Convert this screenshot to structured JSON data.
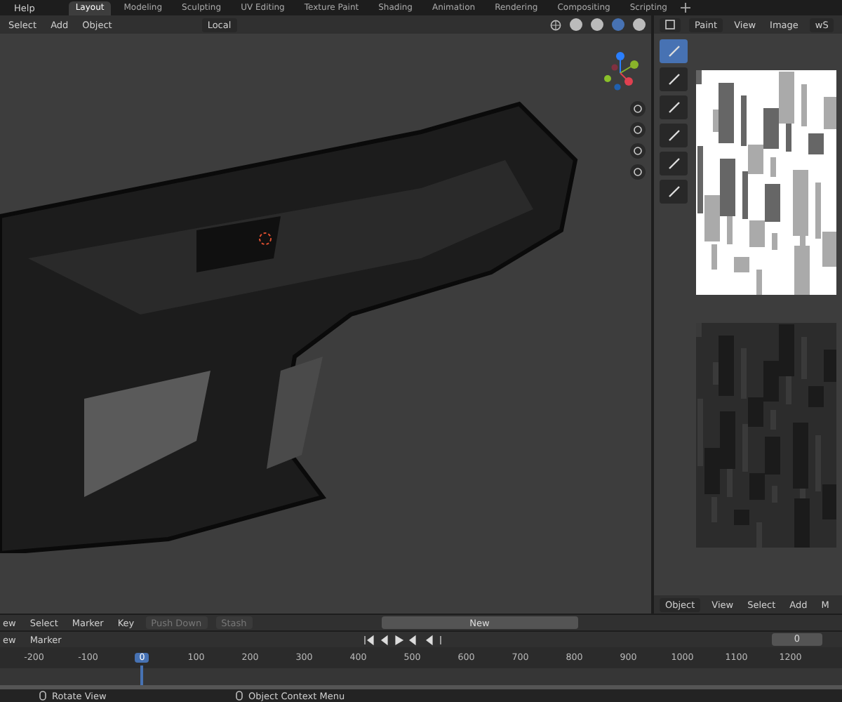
{
  "top_menu": [
    "Help"
  ],
  "workspace_tabs": [
    {
      "label": "Layout",
      "selected": true
    },
    {
      "label": "Modeling",
      "selected": false
    },
    {
      "label": "Sculpting",
      "selected": false
    },
    {
      "label": "UV Editing",
      "selected": false
    },
    {
      "label": "Texture Paint",
      "selected": false
    },
    {
      "label": "Shading",
      "selected": false
    },
    {
      "label": "Animation",
      "selected": false
    },
    {
      "label": "Rendering",
      "selected": false
    },
    {
      "label": "Compositing",
      "selected": false
    },
    {
      "label": "Scripting",
      "selected": false
    }
  ],
  "viewport": {
    "menus": [
      "Select",
      "Add",
      "Object"
    ],
    "orientation": "Local",
    "shading_modes": [
      {
        "selected": false
      },
      {
        "selected": false
      },
      {
        "selected": true
      },
      {
        "selected": false
      }
    ]
  },
  "image_editor": {
    "mode": "Paint",
    "menus": [
      "View",
      "Image"
    ],
    "image_name": "wS",
    "tools": [
      {
        "selected": true
      },
      {
        "selected": false
      },
      {
        "selected": false
      },
      {
        "selected": false
      },
      {
        "selected": false
      },
      {
        "selected": false
      }
    ]
  },
  "lower_header": {
    "mode": "Object",
    "menus": [
      "View",
      "Select",
      "Add",
      "M"
    ]
  },
  "dope_sheet": {
    "menus": [
      "ew",
      "Select",
      "Marker",
      "Key"
    ],
    "buttons": [
      "Push Down",
      "Stash"
    ],
    "action_button": "New"
  },
  "timeline": {
    "menus": [
      "ew",
      "Marker"
    ],
    "current_frame": "0",
    "ruler": [
      {
        "label": "-200",
        "selected": false
      },
      {
        "label": "-100",
        "selected": false
      },
      {
        "label": "0",
        "selected": true
      },
      {
        "label": "100",
        "selected": false
      },
      {
        "label": "200",
        "selected": false
      },
      {
        "label": "300",
        "selected": false
      },
      {
        "label": "400",
        "selected": false
      },
      {
        "label": "500",
        "selected": false
      },
      {
        "label": "600",
        "selected": false
      },
      {
        "label": "700",
        "selected": false
      },
      {
        "label": "800",
        "selected": false
      },
      {
        "label": "900",
        "selected": false
      },
      {
        "label": "1000",
        "selected": false
      },
      {
        "label": "1100",
        "selected": false
      },
      {
        "label": "1200",
        "selected": false
      }
    ]
  },
  "status_bar": [
    "Rotate View",
    "Object Context Menu"
  ]
}
